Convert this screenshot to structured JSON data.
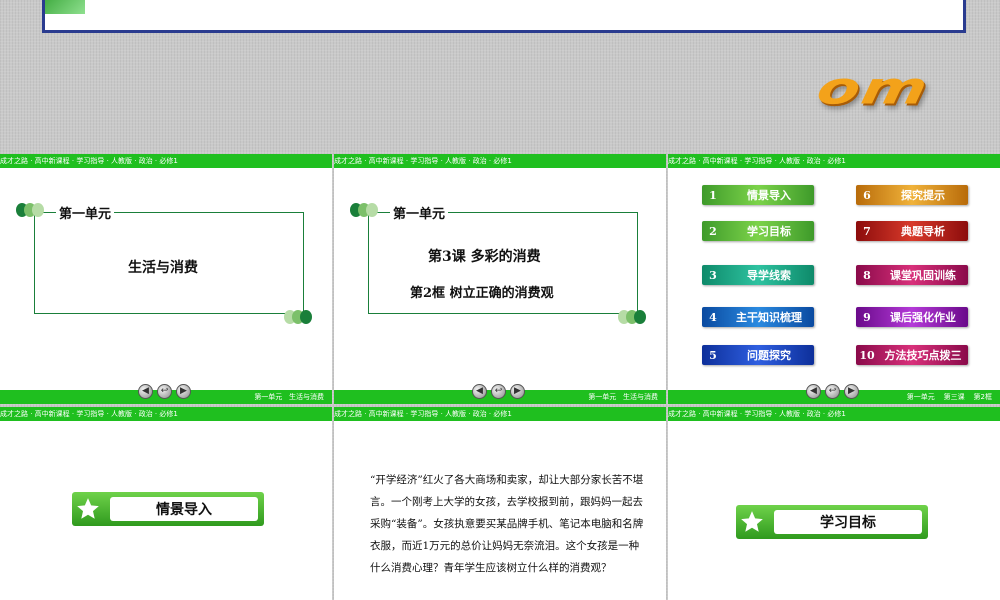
{
  "top": {
    "wordart": "om"
  },
  "header_text": "成才之路 · 高中新课程 · 学习指导 · 人教版 · 政治 · 必修1",
  "slides": {
    "s1": {
      "unit": "第一单元",
      "title": "生活与消费",
      "footer": "第一单元   生活与消费"
    },
    "s2": {
      "unit": "第一单元",
      "lesson": "第3课   多彩的消费",
      "frame": "第2框   树立正确的消费观",
      "footer": "第一单元   生活与消费"
    },
    "s3": {
      "footer": "第一单元    第三课    第2框",
      "menu": [
        {
          "num": "1",
          "label": "情景导入"
        },
        {
          "num": "6",
          "label": "探究提示"
        },
        {
          "num": "2",
          "label": "学习目标"
        },
        {
          "num": "7",
          "label": "典题导析"
        },
        {
          "num": "3",
          "label": "导学线索"
        },
        {
          "num": "8",
          "label": "课堂巩固训练"
        },
        {
          "num": "4",
          "label": "主干知识梳理"
        },
        {
          "num": "9",
          "label": "课后强化作业"
        },
        {
          "num": "5",
          "label": "问题探究"
        },
        {
          "num": "10",
          "label": "方法技巧点拨三"
        }
      ]
    },
    "s4": {
      "button": "情景导入"
    },
    "s5": {
      "paragraph": "“开学经济”红火了各大商场和卖家，却让大部分家长苦不堪言。一个刚考上大学的女孩，去学校报到前，跟妈妈一起去采购“装备”。女孩执意要买某品牌手机、笔记本电脑和名牌衣服，而近1万元的总价让妈妈无奈流泪。这个女孩是一种什么消费心理？青年学生应该树立什么样的消费观？"
    },
    "s6": {
      "button": "学习目标"
    }
  },
  "nav": {
    "prev": "◀",
    "back": "↩",
    "next": "▶"
  },
  "colors": {
    "header_green": "#1fbf1f",
    "frame_green": "#1a7f3a",
    "banner_border": "#2a3b8f",
    "wordart_orange": "#f3a21a"
  }
}
